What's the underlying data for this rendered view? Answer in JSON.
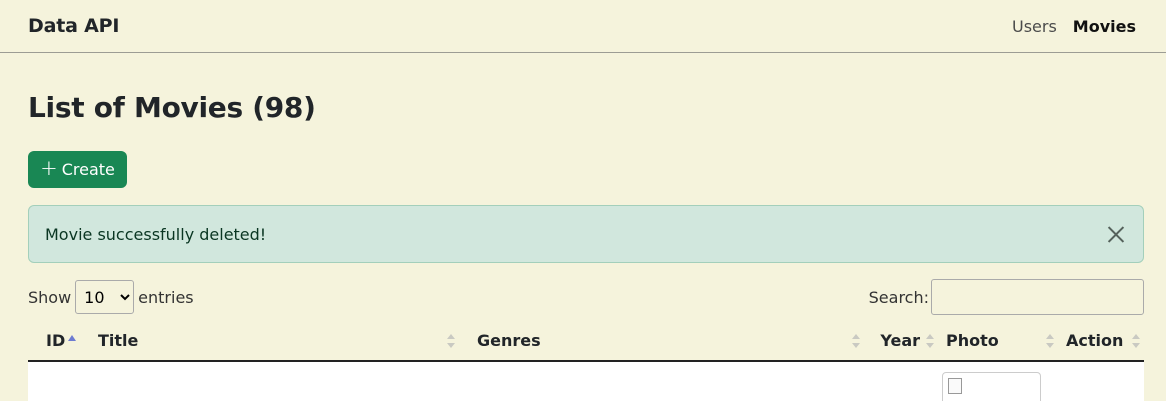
{
  "navbar": {
    "brand": "Data API",
    "links": [
      {
        "label": "Users",
        "active": false
      },
      {
        "label": "Movies",
        "active": true
      }
    ]
  },
  "page": {
    "title": "List of Movies (98)",
    "create_label": "Create"
  },
  "alert": {
    "message": "Movie successfully deleted!",
    "type": "success",
    "colors": {
      "background": "#d1e7dd",
      "text": "#0a3622"
    }
  },
  "table_controls": {
    "show_label": "Show",
    "entries_label": "entries",
    "page_length": "10",
    "search_label": "Search:",
    "search_value": ""
  },
  "table": {
    "columns": [
      "ID",
      "Title",
      "Genres",
      "Year",
      "Photo",
      "Action"
    ],
    "sorted_column": "ID",
    "sort_direction": "asc"
  },
  "colors": {
    "background": "#f5f3dc",
    "create_button": "#198754",
    "sort_active": "#6d7bd1"
  }
}
